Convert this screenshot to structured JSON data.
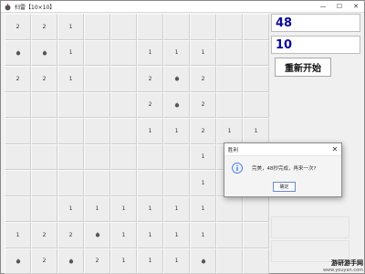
{
  "window": {
    "title": "扫雷【10×10】",
    "minimize": "—",
    "maximize": "☐",
    "close": "✕"
  },
  "panel": {
    "counter_top": "48",
    "counter_bottom": "10",
    "restart_label": "重新开始"
  },
  "grid": {
    "rows": [
      [
        "2",
        "2",
        "1",
        "",
        "",
        "",
        "",
        "",
        "",
        ""
      ],
      [
        "mine",
        "mine",
        "1",
        "",
        "",
        "1",
        "1",
        "1",
        "",
        ""
      ],
      [
        "2",
        "2",
        "1",
        "",
        "",
        "2",
        "mine",
        "2",
        "",
        ""
      ],
      [
        "",
        "",
        "",
        "",
        "",
        "2",
        "mine",
        "2",
        "",
        ""
      ],
      [
        "",
        "",
        "",
        "",
        "",
        "1",
        "1",
        "2",
        "1",
        "1"
      ],
      [
        "",
        "",
        "",
        "",
        "",
        "",
        "",
        "1",
        "",
        ""
      ],
      [
        "",
        "",
        "",
        "",
        "",
        "",
        "",
        "1",
        "",
        ""
      ],
      [
        "",
        "",
        "1",
        "1",
        "1",
        "1",
        "1",
        "1",
        "",
        ""
      ],
      [
        "1",
        "2",
        "2",
        "mine",
        "1",
        "1",
        "1",
        "1",
        "",
        ""
      ],
      [
        "mine",
        "2",
        "mine",
        "2",
        "1",
        "1",
        "1",
        "mine",
        "",
        ""
      ]
    ]
  },
  "dialog": {
    "title": "胜利",
    "message": "完美，48秒完成，再来一次?",
    "ok_label": "确定",
    "close": "✕"
  },
  "watermark": {
    "main": "游研游手网",
    "sub": "www.youyan.com"
  },
  "colors": {
    "counter_text": "#0b0b96",
    "cell_bg": "#ededed",
    "mine": "#555555",
    "info_icon": "#2d6bd6"
  }
}
